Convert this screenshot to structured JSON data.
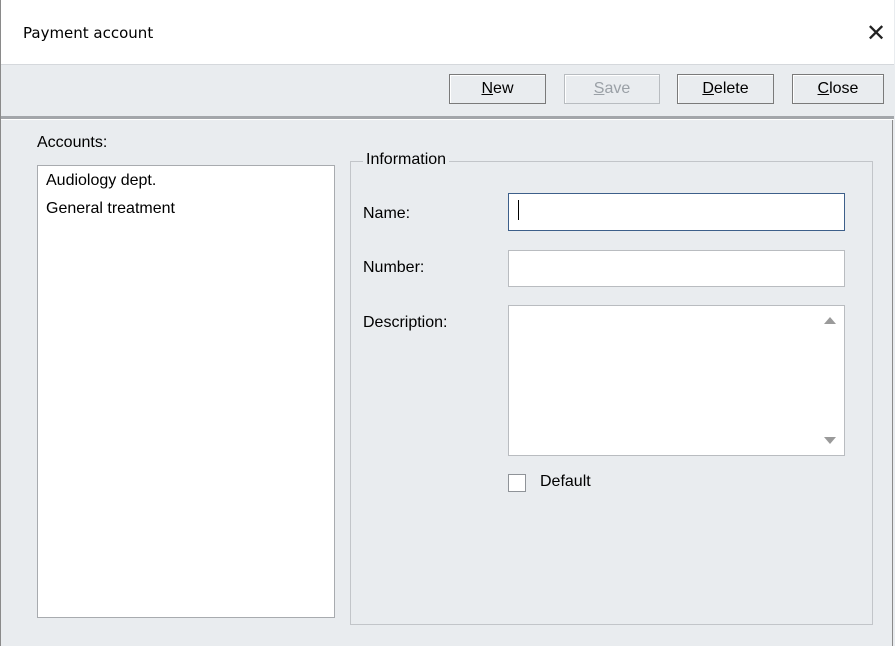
{
  "window": {
    "title": "Payment account",
    "close_icon": "close-icon"
  },
  "toolbar": {
    "buttons": [
      {
        "label": "New",
        "mnemonic": "N",
        "rest": "ew",
        "enabled": true
      },
      {
        "label": "Save",
        "mnemonic": "S",
        "rest": "ave",
        "enabled": false
      },
      {
        "label": "Delete",
        "mnemonic": "D",
        "rest": "elete",
        "enabled": true
      },
      {
        "label": "Close",
        "mnemonic": "C",
        "rest": "lose",
        "enabled": true
      }
    ]
  },
  "accounts": {
    "label": "Accounts:",
    "items": [
      "Audiology dept.",
      "General treatment"
    ]
  },
  "information": {
    "group_title": "Information",
    "name_label": "Name:",
    "name_value": "",
    "number_label": "Number:",
    "number_value": "",
    "description_label": "Description:",
    "description_value": "",
    "default_label": "Default",
    "default_checked": false
  }
}
